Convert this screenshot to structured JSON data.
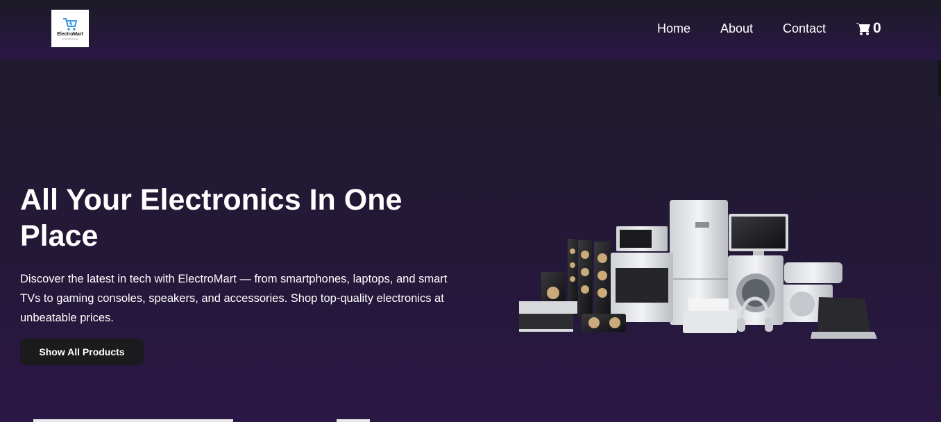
{
  "brand": {
    "name": "ElectroMart",
    "tagline": "Smart Electronics",
    "logo_icon": "shopping-cart-icon",
    "accent_color": "#1e88e5"
  },
  "nav": {
    "items": [
      {
        "label": "Home"
      },
      {
        "label": "About"
      },
      {
        "label": "Contact"
      }
    ],
    "cart_icon": "shopping-cart-icon",
    "cart_count": "0"
  },
  "hero": {
    "title": "All Your Electronics In One Place",
    "description": "Discover the latest in tech with ElectroMart — from smartphones, laptops, and smart TVs to gaming consoles, speakers, and accessories. Shop top-quality electronics at unbeatable prices.",
    "button_label": "Show All Products",
    "image_alt": "electronics-collection-image"
  },
  "colors": {
    "background_top": "#1e1b2a",
    "background_bottom": "#2a1745",
    "button_bg": "#1b1b1d",
    "text": "#ffffff"
  }
}
